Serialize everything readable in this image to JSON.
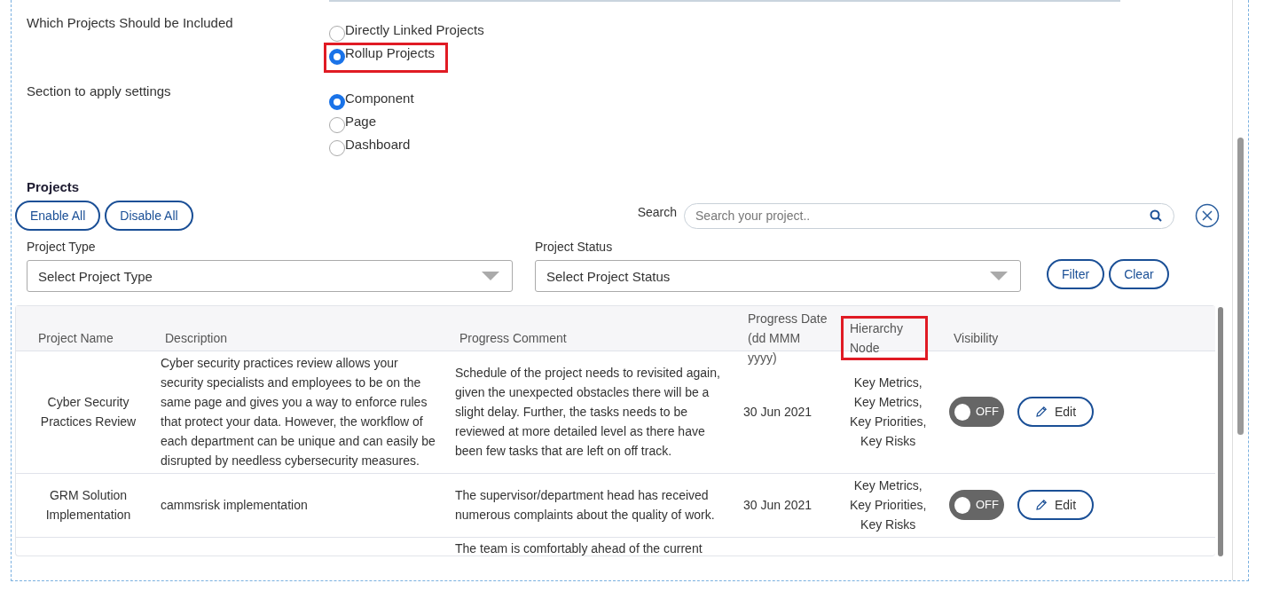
{
  "settings": [
    {
      "label": "Which Projects Should be Included",
      "options": [
        {
          "label": "Directly Linked Projects",
          "selected": false,
          "highlighted": false
        },
        {
          "label": "Rollup Projects",
          "selected": true,
          "highlighted": true
        }
      ]
    },
    {
      "label": "Section to apply settings",
      "options": [
        {
          "label": "Component",
          "selected": true,
          "highlighted": false
        },
        {
          "label": "Page",
          "selected": false,
          "highlighted": false
        },
        {
          "label": "Dashboard",
          "selected": false,
          "highlighted": false
        }
      ]
    }
  ],
  "projects": {
    "title": "Projects",
    "buttons": [
      "Enable All",
      "Disable All"
    ],
    "search": {
      "label": "Search",
      "placeholder": "Search your project.."
    },
    "filters": [
      {
        "label": "Project Type",
        "placeholder": "Select Project Type"
      },
      {
        "label": "Project Status",
        "placeholder": "Select Project Status"
      }
    ],
    "filter_buttons": [
      "Filter",
      "Clear"
    ],
    "table": {
      "columns": [
        {
          "label": "Project Name",
          "highlighted": false
        },
        {
          "label": "Description",
          "highlighted": false
        },
        {
          "label": "Progress Comment",
          "highlighted": false
        },
        {
          "label": "Progress Date (dd MMM yyyy)",
          "highlighted": false
        },
        {
          "label": "Hierarchy Node",
          "highlighted": true
        },
        {
          "label": "Visibility",
          "highlighted": false
        }
      ],
      "rows": [
        {
          "name": "Cyber Security Practices Review",
          "description": "Cyber security practices review allows your security specialists and employees to be on the same page and gives you a way to enforce rules that protect your data. However, the workflow of each department can be unique and can easily be disrupted by needless cybersecurity measures.",
          "comment": "Schedule of the project needs to revisited again, given the unexpected obstacles there will be a slight delay. Further, the tasks needs to be reviewed at more detailed level as there have been few tasks that are left on off track.",
          "date": "30 Jun 2021",
          "nodes": [
            "Key Metrics,",
            "Key Metrics,",
            "Key Priorities,",
            "Key Risks"
          ],
          "visible": false,
          "toggle_label": "OFF",
          "edit": "Edit"
        },
        {
          "name": "GRM Solution Implementation",
          "description": "cammsrisk implementation",
          "comment": "The supervisor/department head has received numerous complaints about the quality of work.",
          "date": "30 Jun 2021",
          "nodes": [
            "Key Metrics,",
            "Key Priorities,",
            "Key Risks"
          ],
          "visible": false,
          "toggle_label": "OFF",
          "edit": "Edit"
        },
        {
          "comment": "The team is comfortably ahead of the current"
        }
      ]
    }
  }
}
